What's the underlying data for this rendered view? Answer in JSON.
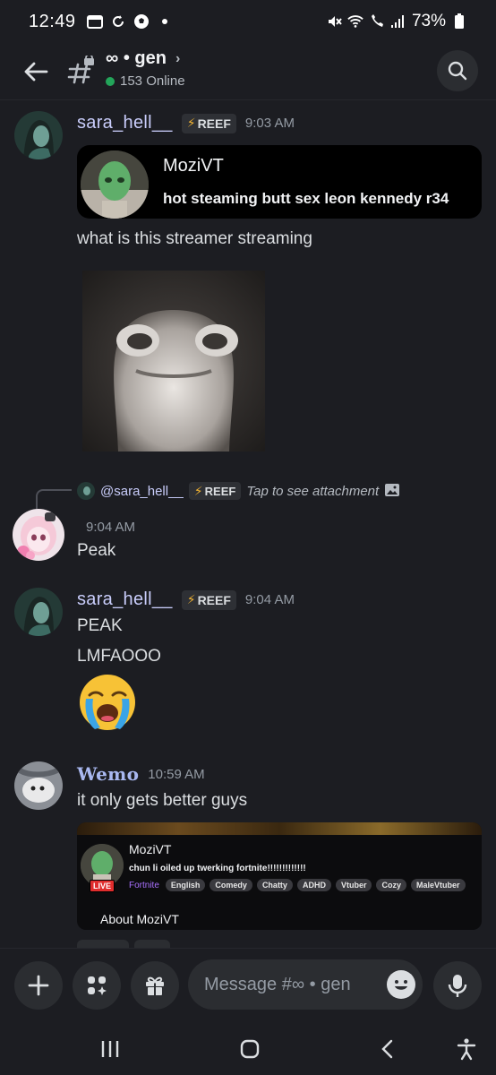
{
  "status_bar": {
    "time": "12:49",
    "battery": "73%"
  },
  "header": {
    "channel_title": "∞ • gen",
    "online_count": "153 Online"
  },
  "messages": [
    {
      "author": "sara_hell__",
      "tag": "REEF",
      "time": "9:03 AM",
      "embed": {
        "name": "MoziVT",
        "title": "hot steaming butt sex leon kennedy r34"
      },
      "text": "what is this streamer streaming"
    },
    {
      "reply": {
        "author": "@sara_hell__",
        "tag": "REEF",
        "text": "Tap to see attachment"
      },
      "time": "9:04 AM",
      "text": "Peak"
    },
    {
      "author": "sara_hell__",
      "tag": "REEF",
      "time": "9:04 AM",
      "lines": [
        "PEAK",
        "LMFAOOO"
      ]
    },
    {
      "author": "Wemo",
      "time": "10:59 AM",
      "text": "it only gets better guys",
      "embed": {
        "name": "MoziVT",
        "title": "chun li oiled up twerking fortnite!!!!!!!!!!!!!",
        "live": "LIVE",
        "game": "Fortnite",
        "tags": [
          "English",
          "Comedy",
          "Chatty",
          "ADHD",
          "Vtuber",
          "Cozy",
          "MaleVtuber"
        ],
        "about": "About MoziVT"
      }
    }
  ],
  "composer": {
    "placeholder": "Message #∞ • gen"
  },
  "colors": {
    "online": "#23a55a",
    "author": "#c9cdfb",
    "bolt": "#f0b232",
    "live": "#e02d2d",
    "game": "#a970ff"
  }
}
